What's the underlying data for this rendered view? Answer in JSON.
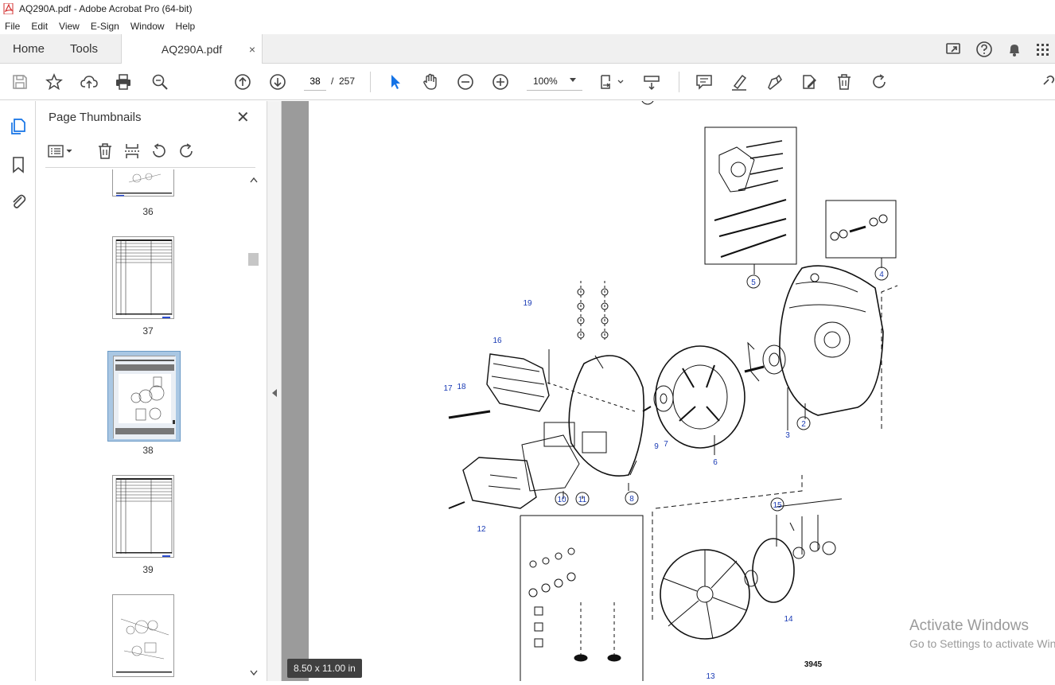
{
  "window": {
    "title": "AQ290A.pdf - Adobe Acrobat Pro (64-bit)"
  },
  "menu": [
    "File",
    "Edit",
    "View",
    "E-Sign",
    "Window",
    "Help"
  ],
  "tabs": {
    "home": "Home",
    "tools": "Tools",
    "document": "AQ290A.pdf",
    "close": "×"
  },
  "toolbar": {
    "current_page": "38",
    "separator": "/",
    "total_pages": "257",
    "zoom": "100%"
  },
  "panel": {
    "title": "Page Thumbnails",
    "close": "✕",
    "thumbnails": [
      {
        "label": "36"
      },
      {
        "label": "37"
      },
      {
        "label": "38",
        "selected": true
      },
      {
        "label": "39"
      },
      {
        "label": ""
      }
    ]
  },
  "document": {
    "page_size": "8.50 x 11.00 in",
    "figure_number": "3945",
    "callouts": [
      "2",
      "3",
      "4",
      "5",
      "6",
      "7",
      "8",
      "9",
      "10",
      "11",
      "12",
      "13",
      "14",
      "15",
      "16",
      "17",
      "18",
      "19"
    ]
  },
  "watermark": {
    "line1": "Activate Windows",
    "line2": "Go to Settings to activate Windows."
  },
  "colors": {
    "accent": "#1473e6",
    "selection": "#a9c7e3",
    "callout": "#1a3bb5"
  }
}
